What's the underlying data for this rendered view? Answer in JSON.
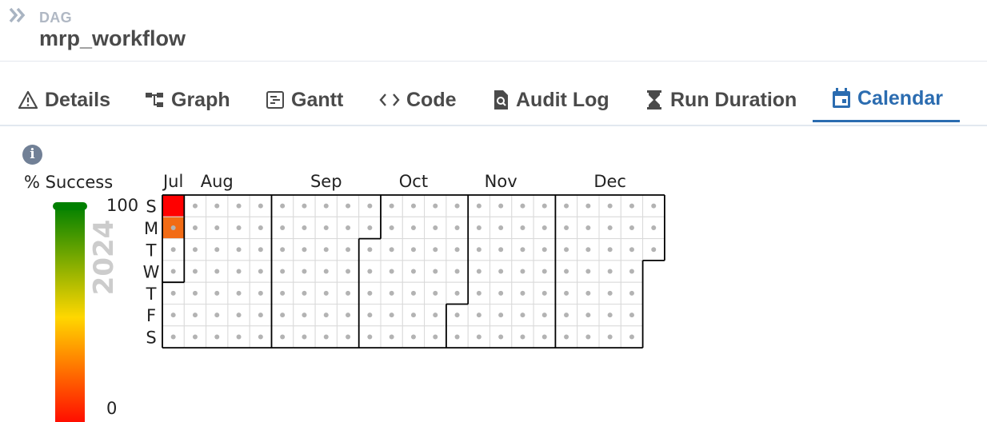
{
  "header": {
    "label": "DAG",
    "dag_name": "mrp_workflow"
  },
  "tabs": [
    {
      "label": "Details",
      "icon": "warning-triangle-icon",
      "active": false
    },
    {
      "label": "Graph",
      "icon": "graph-icon",
      "active": false
    },
    {
      "label": "Gantt",
      "icon": "gantt-icon",
      "active": false
    },
    {
      "label": "Code",
      "icon": "code-icon",
      "active": false
    },
    {
      "label": "Audit Log",
      "icon": "audit-log-icon",
      "active": false
    },
    {
      "label": "Run Duration",
      "icon": "hourglass-icon",
      "active": false
    },
    {
      "label": "Calendar",
      "icon": "calendar-icon",
      "active": true
    }
  ],
  "info": {
    "icon": "info-icon",
    "glyph": "i"
  },
  "calendar": {
    "legend_title": "% Success",
    "legend_max": "100",
    "legend_min": "0",
    "year": "2024",
    "months": [
      "Jul",
      "Aug",
      "Sep",
      "Oct",
      "Nov",
      "Dec"
    ],
    "weekdays": [
      "S",
      "M",
      "T",
      "W",
      "T",
      "F",
      "S"
    ],
    "start_date": "2024-07-28",
    "end_date": "2024-12-31",
    "runs": [
      {
        "date": "2024-07-28",
        "success_pct": 0
      },
      {
        "date": "2024-07-29",
        "success_pct": 40
      }
    ],
    "colors": {
      "accent": "#2b6cb0",
      "grid": "#d9d9d9",
      "dot": "#b3b3b3",
      "failed": "#ff0000",
      "partial": "#f26b15",
      "success": "#008000"
    }
  }
}
